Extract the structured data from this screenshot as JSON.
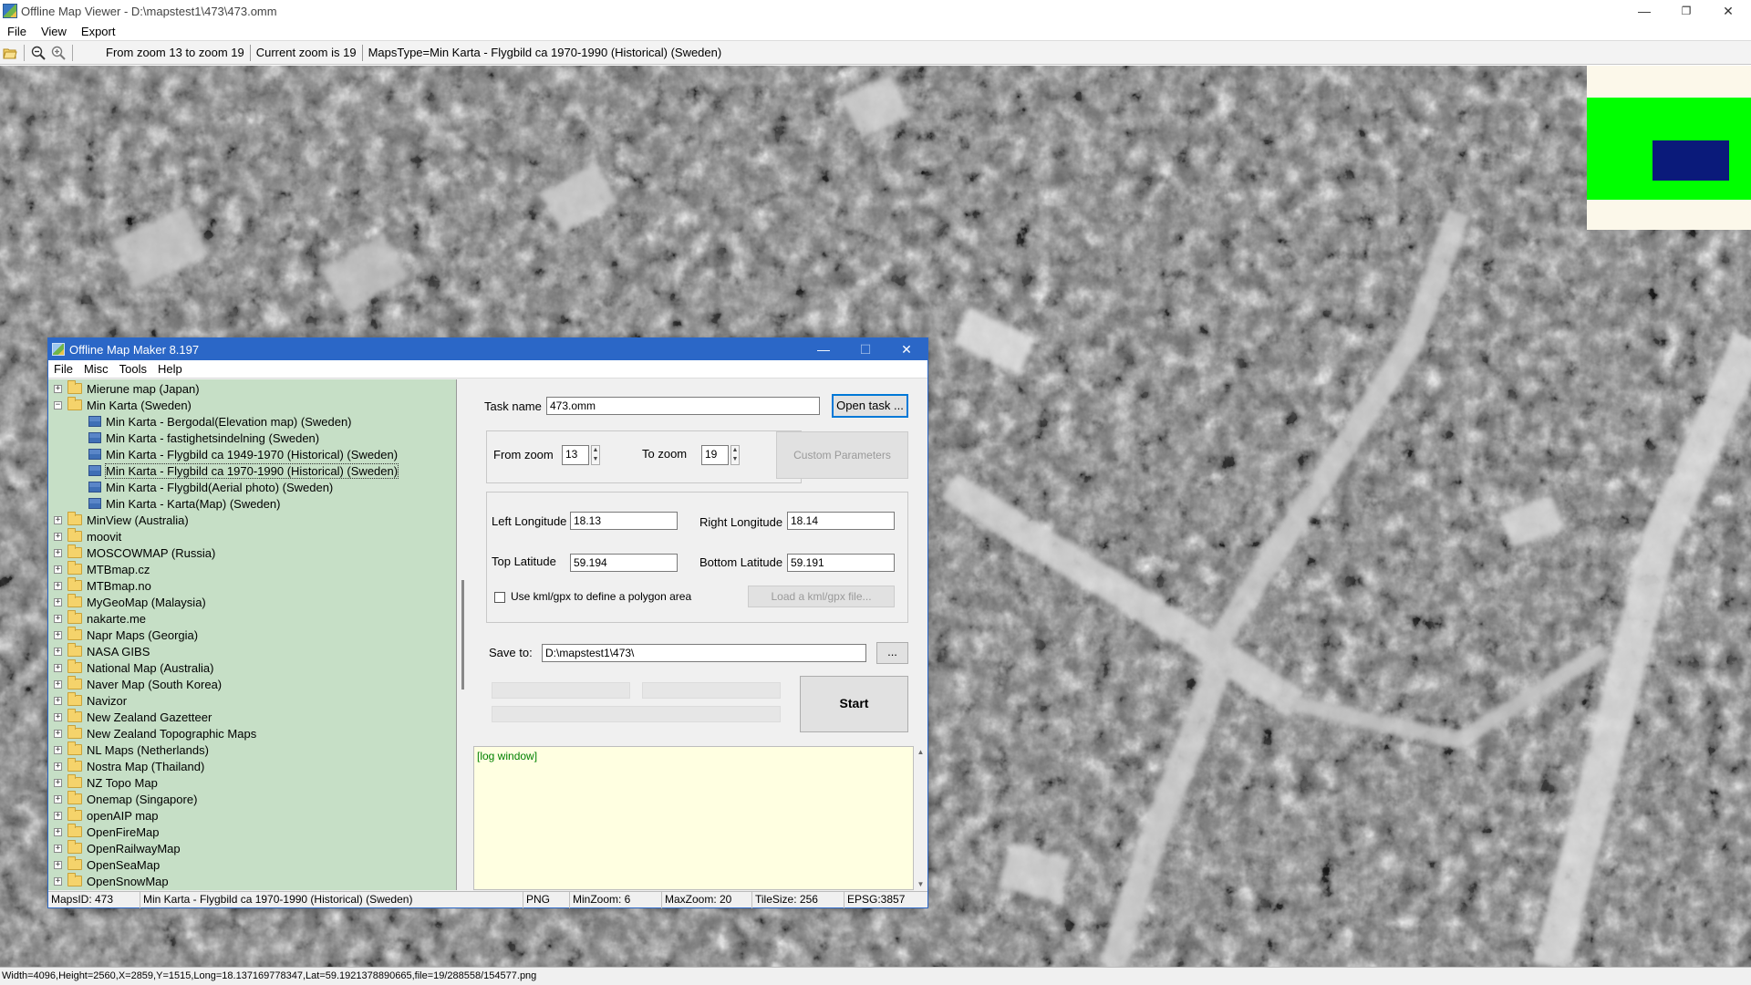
{
  "window": {
    "title": "Offline Map Viewer - D:\\mapstest1\\473\\473.omm",
    "minimize": "—",
    "maximize": "❐",
    "close": "✕"
  },
  "menu": [
    "File",
    "View",
    "Export"
  ],
  "toolbar": {
    "open_icon": "folder-open-icon",
    "zoom_out_icon": "zoom-out-icon",
    "zoom_in_icon": "zoom-in-icon",
    "zoom_range": "From zoom 13 to zoom 19",
    "current_zoom": "Current zoom is 19",
    "maps_type": "MapsType=Min Karta - Flygbild ca 1970-1990 (Historical) (Sweden)"
  },
  "status_bar": "Width=4096,Height=2560,X=2859,Y=1515,Long=18.137169778347,Lat=59.1921378890665,file=19/288558/154577.png",
  "overview": {
    "background": "#fcf8ea",
    "area": "#00ff00",
    "viewport": "#0a1a7a"
  },
  "dialog": {
    "title": "Offline Map Maker 8.197",
    "minimize": "—",
    "maximize": "☐",
    "close": "✕",
    "menu": [
      "File",
      "Misc",
      "Tools",
      "Help"
    ],
    "tree": [
      {
        "label": "Mierune map (Japan)",
        "level": 0,
        "expander": "+"
      },
      {
        "label": "Min Karta (Sweden)",
        "level": 0,
        "expander": "−",
        "open": true
      },
      {
        "label": "Min Karta - Bergodal(Elevation map) (Sweden)",
        "level": 1
      },
      {
        "label": "Min Karta - fastighetsindelning (Sweden)",
        "level": 1
      },
      {
        "label": "Min Karta - Flygbild ca 1949-1970 (Historical) (Sweden)",
        "level": 1
      },
      {
        "label": "Min Karta - Flygbild ca 1970-1990 (Historical) (Sweden)",
        "level": 1,
        "selected": true
      },
      {
        "label": "Min Karta - Flygbild(Aerial photo) (Sweden)",
        "level": 1
      },
      {
        "label": "Min Karta - Karta(Map) (Sweden)",
        "level": 1
      },
      {
        "label": "MinView (Australia)",
        "level": 0,
        "expander": "+"
      },
      {
        "label": "moovit",
        "level": 0,
        "expander": "+"
      },
      {
        "label": "MOSCOWMAP (Russia)",
        "level": 0,
        "expander": "+"
      },
      {
        "label": "MTBmap.cz",
        "level": 0,
        "expander": "+"
      },
      {
        "label": "MTBmap.no",
        "level": 0,
        "expander": "+"
      },
      {
        "label": "MyGeoMap (Malaysia)",
        "level": 0,
        "expander": "+"
      },
      {
        "label": "nakarte.me",
        "level": 0,
        "expander": "+"
      },
      {
        "label": "Napr Maps (Georgia)",
        "level": 0,
        "expander": "+"
      },
      {
        "label": "NASA GIBS",
        "level": 0,
        "expander": "+"
      },
      {
        "label": "National Map (Australia)",
        "level": 0,
        "expander": "+"
      },
      {
        "label": "Naver Map (South Korea)",
        "level": 0,
        "expander": "+"
      },
      {
        "label": "Navizor",
        "level": 0,
        "expander": "+"
      },
      {
        "label": "New Zealand Gazetteer",
        "level": 0,
        "expander": "+"
      },
      {
        "label": "New Zealand Topographic Maps",
        "level": 0,
        "expander": "+"
      },
      {
        "label": "NL Maps (Netherlands)",
        "level": 0,
        "expander": "+"
      },
      {
        "label": "Nostra Map (Thailand)",
        "level": 0,
        "expander": "+"
      },
      {
        "label": "NZ Topo Map",
        "level": 0,
        "expander": "+"
      },
      {
        "label": "Onemap (Singapore)",
        "level": 0,
        "expander": "+"
      },
      {
        "label": "openAIP map",
        "level": 0,
        "expander": "+"
      },
      {
        "label": "OpenFireMap",
        "level": 0,
        "expander": "+"
      },
      {
        "label": "OpenRailwayMap",
        "level": 0,
        "expander": "+"
      },
      {
        "label": "OpenSeaMap",
        "level": 0,
        "expander": "+"
      },
      {
        "label": "OpenSnowMap",
        "level": 0,
        "expander": "+"
      }
    ],
    "task_name_label": "Task name",
    "task_name": "473.omm",
    "open_task": "Open task ...",
    "from_zoom_label": "From zoom",
    "from_zoom": "13",
    "to_zoom_label": "To zoom",
    "to_zoom": "19",
    "custom_params": "Custom Parameters",
    "left_lon_label": "Left Longitude",
    "left_lon": "18.13",
    "right_lon_label": "Right Longitude",
    "right_lon": "18.14",
    "top_lat_label": "Top Latitude",
    "top_lat": "59.194",
    "bottom_lat_label": "Bottom Latitude",
    "bottom_lat": "59.191",
    "kml_checkbox": "Use kml/gpx to define a polygon area",
    "load_kml": "Load a kml/gpx file...",
    "save_to_label": "Save to:",
    "save_to": "D:\\mapstest1\\473\\",
    "browse": "...",
    "start": "Start",
    "log_text": "[log window]",
    "status": {
      "maps_id": "MapsID: 473",
      "map_name": "Min Karta - Flygbild ca 1970-1990 (Historical) (Sweden)",
      "format": "PNG",
      "min_zoom": "MinZoom: 6",
      "max_zoom": "MaxZoom: 20",
      "tile_size": "TileSize: 256",
      "epsg": "EPSG:3857"
    }
  }
}
